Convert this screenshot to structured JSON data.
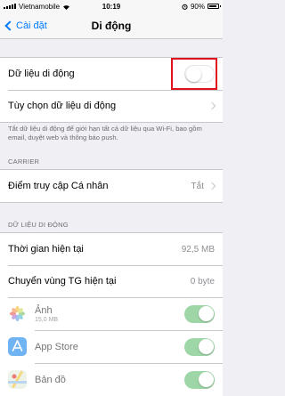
{
  "status_bar": {
    "carrier": "Vietnamobile",
    "time": "10:19",
    "battery": "90%",
    "battery_level": 0.9
  },
  "nav": {
    "back_label": "Cài đặt",
    "title": "Di động"
  },
  "main_group": {
    "cellular_data_label": "Dữ liệu di động",
    "cellular_data_on": false,
    "options_label": "Tùy chọn dữ liệu di động"
  },
  "footnote": "Tắt dữ liệu di động để giới hạn tất cả dữ liệu qua Wi-Fi, bao gồm email, duyệt web và thông báo push.",
  "carrier_section": {
    "header": "CARRIER",
    "hotspot_label": "Điểm truy cập Cá nhân",
    "hotspot_value": "Tắt"
  },
  "data_section": {
    "header": "DỮ LIỆU DI ĐỘNG",
    "current_period_label": "Thời gian hiện tại",
    "current_period_value": "92,5 MB",
    "roaming_label": "Chuyển vùng TG hiện tại",
    "roaming_value": "0 byte"
  },
  "apps": [
    {
      "name": "Ảnh",
      "usage": "15,0 MB",
      "icon": "photos-icon",
      "enabled": true
    },
    {
      "name": "App Store",
      "usage": "",
      "icon": "app-store-icon",
      "enabled": true
    },
    {
      "name": "Bản đồ",
      "usage": "",
      "icon": "maps-icon",
      "enabled": true
    }
  ],
  "colors": {
    "accent": "#007aff",
    "toggle_on": "#7fc98a",
    "highlight": "#e0121b",
    "background": "#efeff4"
  }
}
